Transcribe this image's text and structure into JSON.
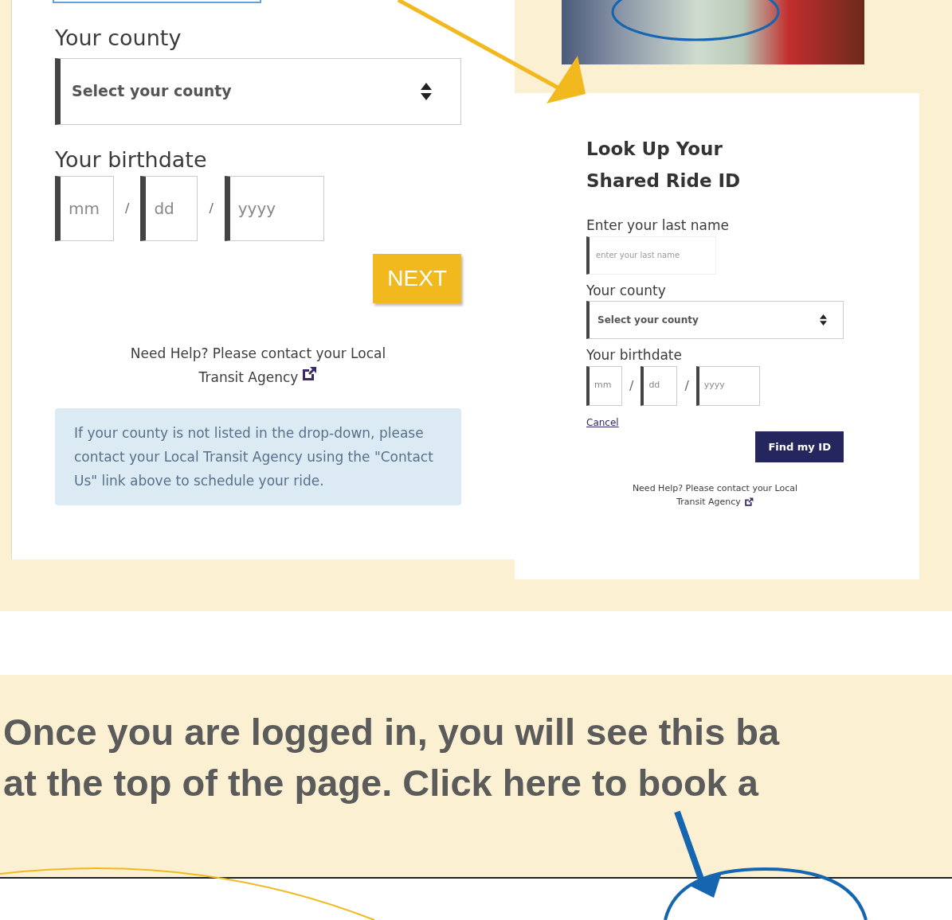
{
  "left_form": {
    "county_label": "Your county",
    "county_placeholder": "Select your county",
    "birthdate_label": "Your birthdate",
    "date_fields": [
      {
        "placeholder": "mm"
      },
      {
        "placeholder": "dd"
      },
      {
        "placeholder": "yyyy"
      }
    ],
    "separators": [
      "/",
      "/"
    ],
    "next_button": "NEXT",
    "help_text": [
      "Need Help? Please contact your Local",
      "Transit Agency"
    ],
    "alert": "If your county is not listed in the drop-down, please contact your Local Transit Agency using the \"Contact Us\" link above to schedule your ride."
  },
  "right_form": {
    "title": "Look Up Your Shared Ride ID",
    "last_name_label": "Enter your last name",
    "last_name_placeholder": "enter your last name",
    "county_label": "Your county",
    "county_placeholder": "Select your county",
    "birthdate_label": "Your birthdate",
    "date_fields": [
      {
        "placeholder": "mm"
      },
      {
        "placeholder": "dd"
      },
      {
        "placeholder": "yyyy"
      }
    ],
    "separators": [
      "/",
      "/"
    ],
    "cancel_link": "Cancel",
    "find_button": "Find my ID",
    "help_text": [
      "Need Help? Please contact your Local",
      "Transit Agency"
    ]
  },
  "headline": [
    "Once you are logged in, you will see this ba",
    "at the top of the page. Click here to book a"
  ]
}
